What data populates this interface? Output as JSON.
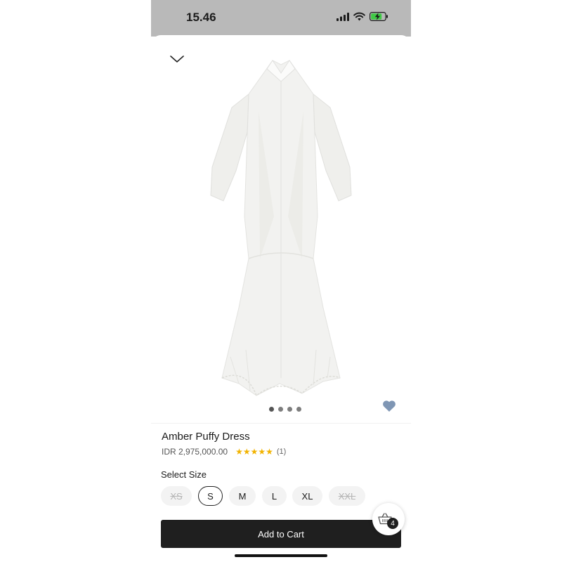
{
  "status_bar": {
    "time": "15.46",
    "icons": [
      "signal-icon",
      "wifi-icon",
      "battery-charging-icon"
    ]
  },
  "product": {
    "name": "Amber Puffy Dress",
    "price": "IDR 2,975,000.00",
    "rating_stars": "★★★★★",
    "rating_value": 5,
    "review_count": "(1)",
    "image_dots": 4,
    "active_dot": 0
  },
  "size_section": {
    "label": "Select Size",
    "sizes": [
      {
        "label": "XS",
        "available": false,
        "selected": false
      },
      {
        "label": "S",
        "available": true,
        "selected": true
      },
      {
        "label": "M",
        "available": true,
        "selected": false
      },
      {
        "label": "L",
        "available": true,
        "selected": false
      },
      {
        "label": "XL",
        "available": true,
        "selected": false
      },
      {
        "label": "XXL",
        "available": false,
        "selected": false
      }
    ]
  },
  "cta": {
    "label": "Add to Cart"
  },
  "cart": {
    "count": "4"
  },
  "colors": {
    "status_bar_bg": "#b9b9b9",
    "cta_bg": "#1f1f1f",
    "star": "#f2b300",
    "wishlist_heart": "#7f96b4"
  }
}
